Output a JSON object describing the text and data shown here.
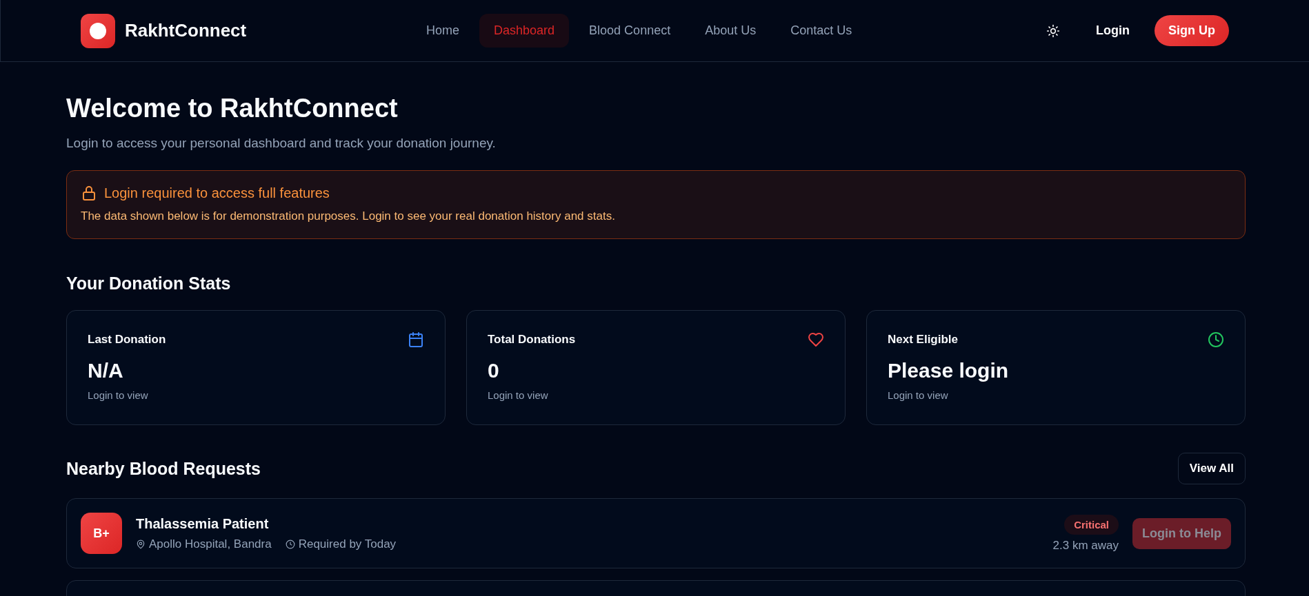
{
  "brand": {
    "name": "RakhtConnect"
  },
  "nav": [
    {
      "label": "Home",
      "selected": false
    },
    {
      "label": "Dashboard",
      "selected": true
    },
    {
      "label": "Blood Connect",
      "selected": false
    },
    {
      "label": "About Us",
      "selected": false
    },
    {
      "label": "Contact Us",
      "selected": false
    }
  ],
  "header_actions": {
    "login": "Login",
    "signup": "Sign Up"
  },
  "page": {
    "title": "Welcome to RakhtConnect",
    "subtitle": "Login to access your personal dashboard and track your donation journey."
  },
  "alert": {
    "title": "Login required to access full features",
    "message": "The data shown below is for demonstration purposes. Login to see your real donation history and stats."
  },
  "stats": {
    "heading": "Your Donation Stats",
    "cards": [
      {
        "label": "Last Donation",
        "value": "N/A",
        "note": "Login to view",
        "kind": "calendar"
      },
      {
        "label": "Total Donations",
        "value": "0",
        "note": "Login to view",
        "kind": "heart"
      },
      {
        "label": "Next Eligible",
        "value": "Please login",
        "note": "Login to view",
        "kind": "clock"
      }
    ]
  },
  "requests": {
    "heading": "Nearby Blood Requests",
    "view_all": "View All",
    "items": [
      {
        "blood_group": "B+",
        "patient": "Thalassemia Patient",
        "location": "Apollo Hospital, Bandra",
        "required": "Required by Today",
        "urgency": "Critical",
        "distance": "2.3 km away",
        "action": "Login to Help",
        "disabled": true
      }
    ]
  }
}
